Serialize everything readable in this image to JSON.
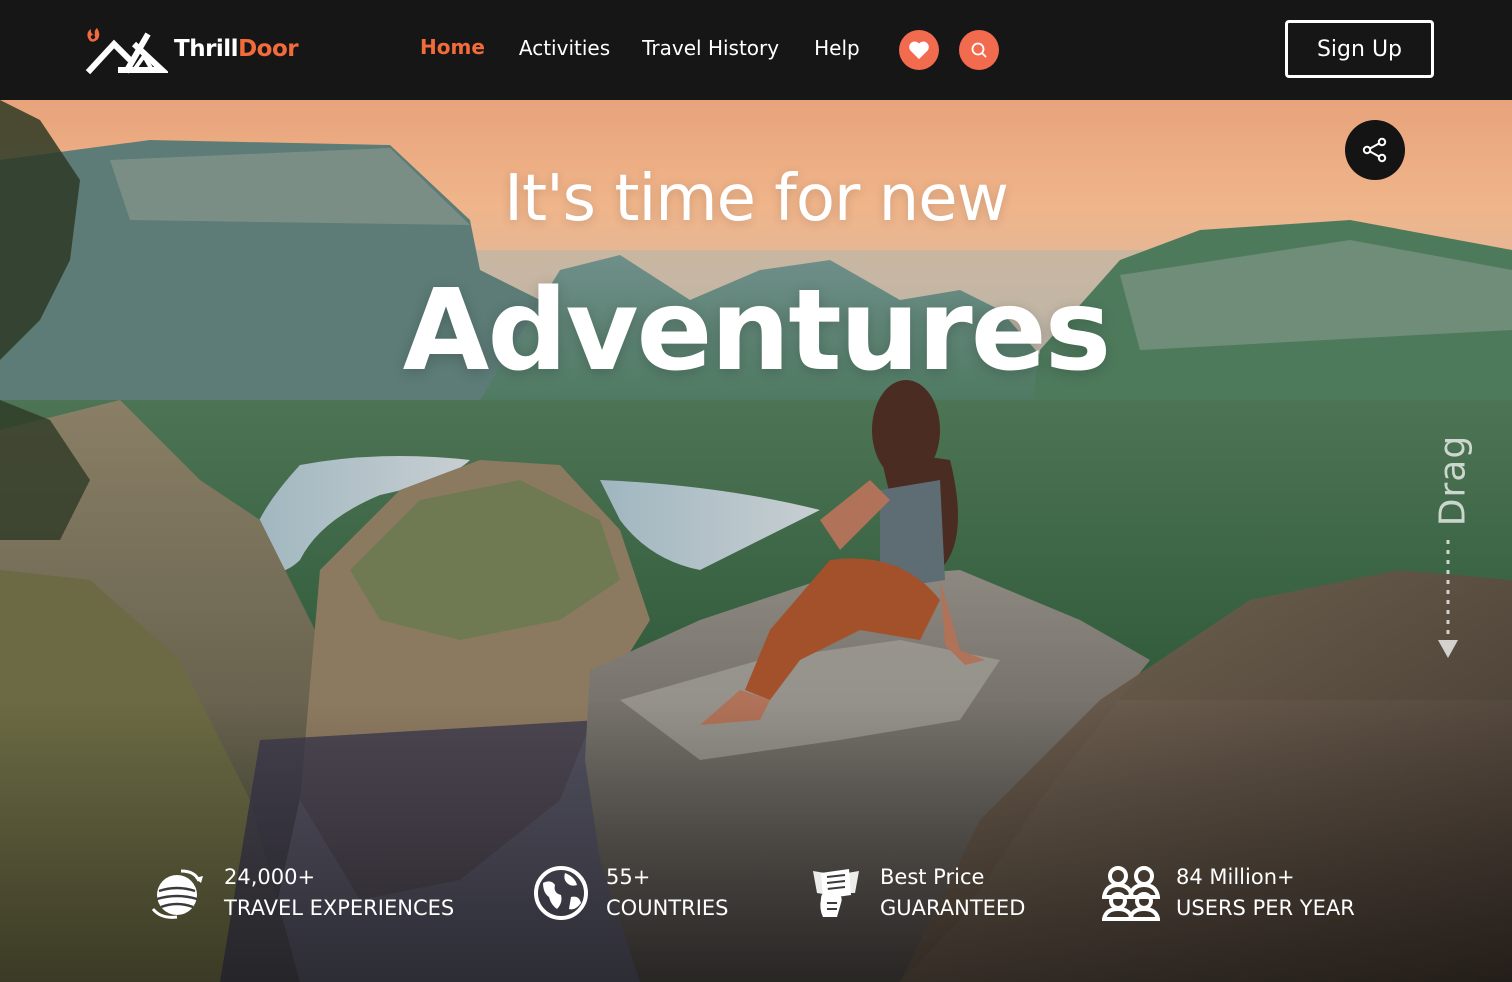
{
  "brand": {
    "name_part1": "Thrill",
    "name_part2": "Door",
    "accent_color": "#f26b3a"
  },
  "nav": {
    "items": [
      {
        "label": "Home",
        "active": true
      },
      {
        "label": "Activities",
        "active": false
      },
      {
        "label": "Travel History",
        "active": false
      },
      {
        "label": "Help",
        "active": false
      }
    ],
    "icons": [
      "heart-icon",
      "search-icon"
    ],
    "signup_label": "Sign Up"
  },
  "hero": {
    "headline_small": "It's time for new",
    "headline_big": "Adventures",
    "drag_label": "Drag",
    "share_icon": "share-icon"
  },
  "stats": [
    {
      "value": "24,000+",
      "label": "TRAVEL EXPERIENCES",
      "icon": "globe-plane-icon"
    },
    {
      "value": "55+",
      "label": "COUNTRIES",
      "icon": "globe-icon"
    },
    {
      "value": "Best Price",
      "label": "GUARANTEED",
      "icon": "money-icon"
    },
    {
      "value": "84 Million+",
      "label": "USERS PER YEAR",
      "icon": "users-icon"
    }
  ]
}
